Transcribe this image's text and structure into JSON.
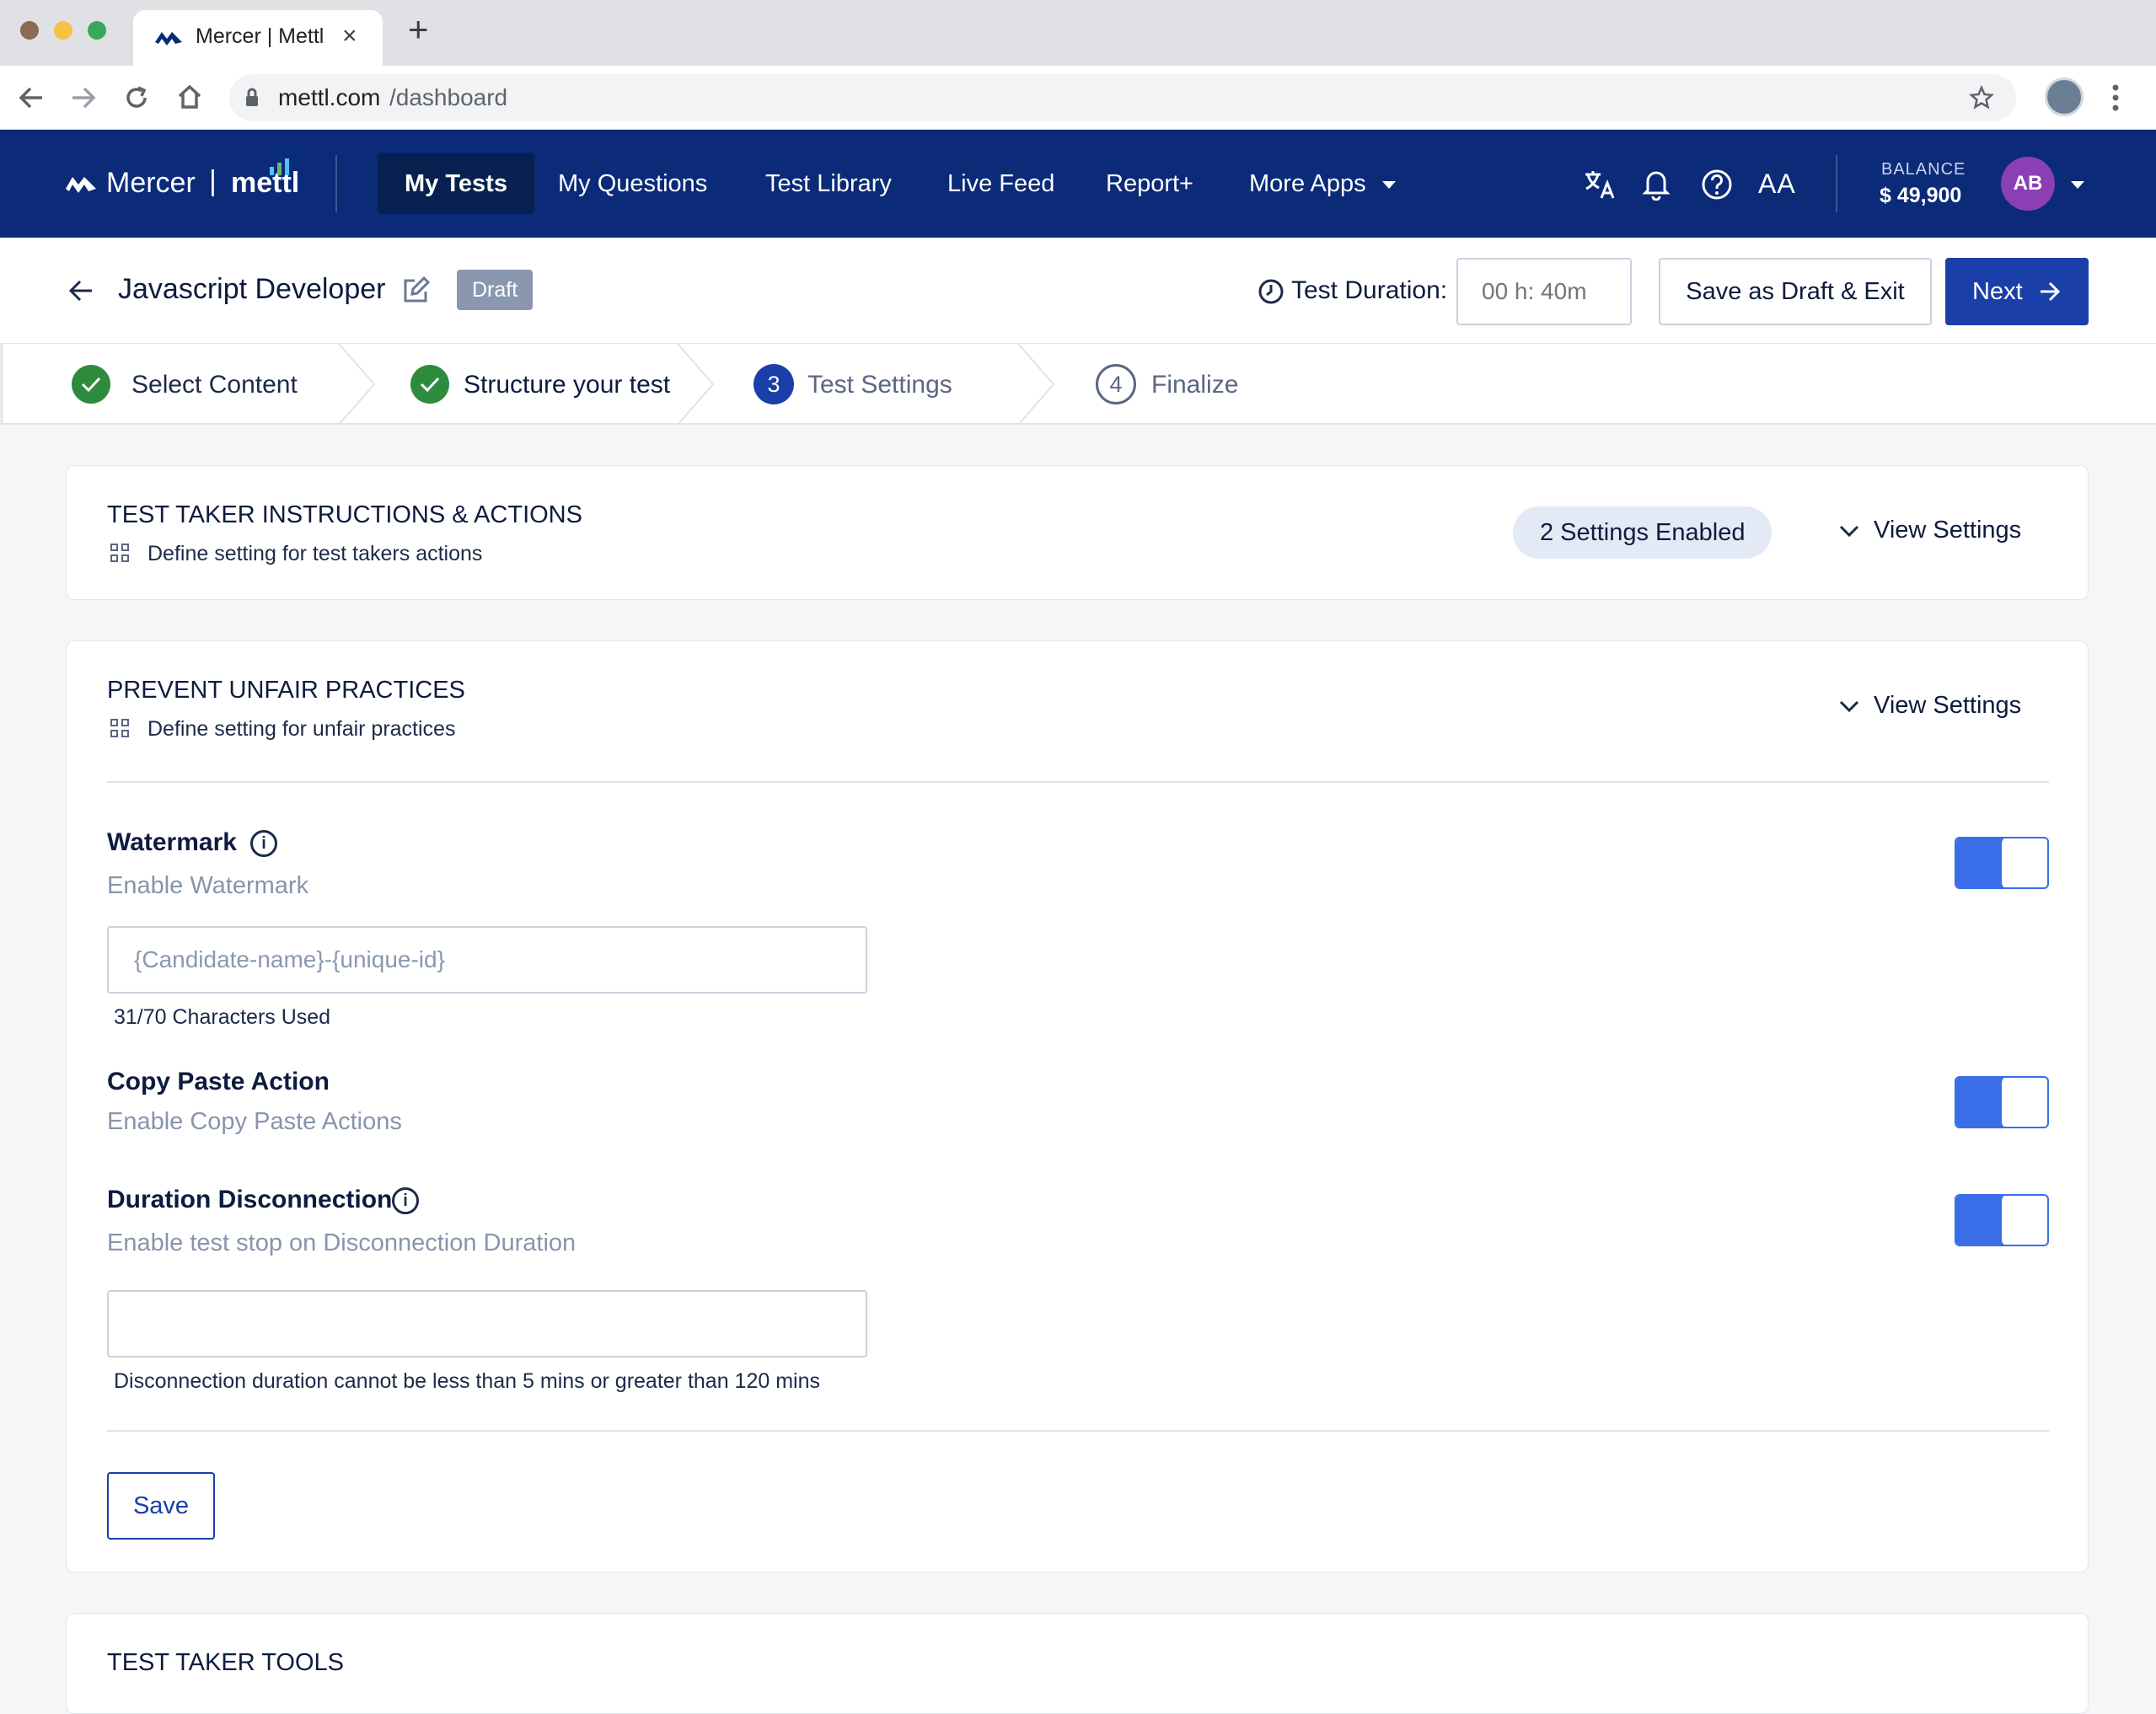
{
  "browser": {
    "tab_title": "Mercer | Mettl",
    "url_domain": "mettl.com",
    "url_path": "/dashboard",
    "new_tab": "+",
    "close_tab": "×"
  },
  "nav": {
    "brand_mercer": "Mercer",
    "brand_sep": "|",
    "brand_mettl": "mettl",
    "items": [
      "My Tests",
      "My Questions",
      "Test Library",
      "Live Feed",
      "Report+",
      "More Apps"
    ],
    "font_label": "AA",
    "balance_label": "BALANCE",
    "balance_value": "$ 49,900",
    "avatar": "AB"
  },
  "header": {
    "title": "Javascript Developer",
    "status": "Draft",
    "duration_label": "Test Duration:",
    "duration_placeholder": "00 h: 40m",
    "save_draft": "Save as Draft & Exit",
    "next": "Next"
  },
  "steps": [
    {
      "label": "Select Content",
      "state": "done"
    },
    {
      "label": "Structure your test",
      "state": "done"
    },
    {
      "num": "3",
      "label": "Test Settings",
      "state": "active"
    },
    {
      "num": "4",
      "label": "Finalize",
      "state": "pending"
    }
  ],
  "sections": {
    "instructions": {
      "title": "TEST TAKER INSTRUCTIONS & ACTIONS",
      "desc": "Define setting for test takers actions",
      "badge": "2 Settings Enabled",
      "view": "View Settings"
    },
    "unfair": {
      "title": "PREVENT UNFAIR PRACTICES",
      "desc": "Define setting for unfair practices",
      "view": "View Settings",
      "watermark": {
        "label": "Watermark",
        "sub": "Enable Watermark",
        "placeholder": "{Candidate-name}-{unique-id}",
        "count": "31/70 Characters Used",
        "enabled": true
      },
      "copypaste": {
        "label": "Copy Paste Action",
        "sub": "Enable Copy Paste Actions",
        "enabled": true
      },
      "disconnection": {
        "label": "Duration Disconnection",
        "sub": "Enable test stop on Disconnection Duration",
        "hint": "Disconnection duration cannot be less than 5 mins or greater than 120 mins",
        "enabled": true
      },
      "save": "Save"
    },
    "tools": {
      "title": "TEST TAKER TOOLS"
    }
  },
  "colors": {
    "nav_bg": "#0b2a78",
    "accent": "#3a6ee8",
    "success": "#2e8b3e",
    "step_active": "#1a3fa8"
  }
}
